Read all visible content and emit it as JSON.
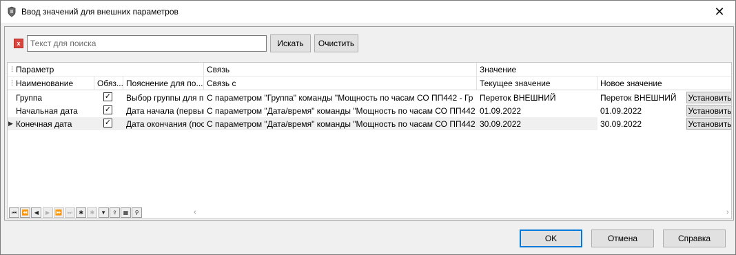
{
  "window": {
    "title": "Ввод значений для внешних параметров",
    "close_glyph": "✕"
  },
  "search": {
    "placeholder": "Текст для поиска",
    "value": "",
    "clear_glyph": "x",
    "search_button": "Искать",
    "clear_button": "Очистить"
  },
  "grid": {
    "band_headers": [
      "Параметр",
      "Связь",
      "Значение"
    ],
    "columns": [
      "Наименование",
      "Обяз...",
      "Пояснение для по...",
      "Связь с",
      "Текущее значение",
      "Новое значение"
    ],
    "rows": [
      {
        "name": "Группа",
        "required": true,
        "explanation": "Выбор группы для п",
        "link": "С параметром \"Группа\" команды \"Мощность по часам СО ПП442 - Гр",
        "current": "Переток ВНЕШНИЙ",
        "new": "Переток ВНЕШНИЙ",
        "action": "Установить"
      },
      {
        "name": "Начальная дата",
        "required": true,
        "explanation": "Дата начала (первый",
        "link": "С параметром \"Дата/время\" команды \"Мощность по часам СО ПП442",
        "current": "01.09.2022",
        "new": "01.09.2022",
        "action": "Установить"
      },
      {
        "name": "Конечная дата",
        "required": true,
        "explanation": "Дата окончания (пос",
        "link": "С параметром \"Дата/время\" команды \"Мощность по часам СО ПП442",
        "current": "30.09.2022",
        "new": "30.09.2022",
        "action": "Установить"
      }
    ]
  },
  "navigator": {
    "buttons": [
      {
        "icon": "first-icon",
        "glyph": "⏮",
        "enabled": true
      },
      {
        "icon": "prev-page-icon",
        "glyph": "⏪",
        "enabled": true
      },
      {
        "icon": "prev-icon",
        "glyph": "◀",
        "enabled": true
      },
      {
        "icon": "next-icon",
        "glyph": "▶",
        "enabled": false
      },
      {
        "icon": "next-page-icon",
        "glyph": "⏩",
        "enabled": false
      },
      {
        "icon": "last-icon",
        "glyph": "⏭",
        "enabled": false
      },
      {
        "icon": "asterisk-icon",
        "glyph": "✱",
        "enabled": true
      },
      {
        "icon": "asterisk-disabled-icon",
        "glyph": "✱",
        "enabled": false
      },
      {
        "icon": "filter-icon",
        "glyph": "▼",
        "enabled": true
      },
      {
        "icon": "export-icon",
        "glyph": "⇪",
        "enabled": true
      },
      {
        "icon": "grid-settings-icon",
        "glyph": "▦",
        "enabled": true
      },
      {
        "icon": "find-icon",
        "glyph": "⚲",
        "enabled": true
      }
    ]
  },
  "footer": {
    "ok": "OK",
    "cancel": "Отмена",
    "help": "Справка"
  }
}
